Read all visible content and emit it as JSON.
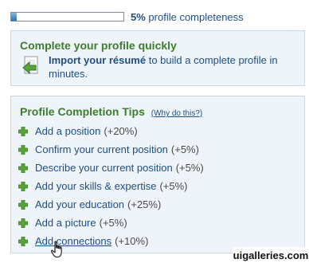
{
  "progress": {
    "percent_label": "5%",
    "suffix": "profile completeness",
    "value_fraction": 0.05
  },
  "quick": {
    "title": "Complete your profile quickly",
    "import_link": "Import your résumé",
    "import_rest": "to build a complete profile in minutes."
  },
  "tips": {
    "title": "Profile Completion Tips",
    "why_link": "(Why do this?)",
    "items": [
      {
        "label": "Add a position",
        "gain": "(+20%)"
      },
      {
        "label": "Confirm your current position",
        "gain": "(+5%)"
      },
      {
        "label": "Describe your current position",
        "gain": "(+5%)"
      },
      {
        "label": "Add your skills & expertise",
        "gain": "(+5%)"
      },
      {
        "label": "Add your education",
        "gain": "(+25%)"
      },
      {
        "label": "Add a picture",
        "gain": "(+5%)"
      },
      {
        "label": "Add connections",
        "gain": "(+10%)"
      }
    ]
  },
  "watermark": "uigalleries.com",
  "colors": {
    "title_green": "#3d7e2c",
    "link_blue": "#1f4f84",
    "box_bg": "#eef4fa",
    "plus_green": "#5aa33a"
  },
  "icons": {
    "import": "document-import-icon",
    "plus": "plus-icon",
    "cursor": "hand-cursor-icon"
  }
}
